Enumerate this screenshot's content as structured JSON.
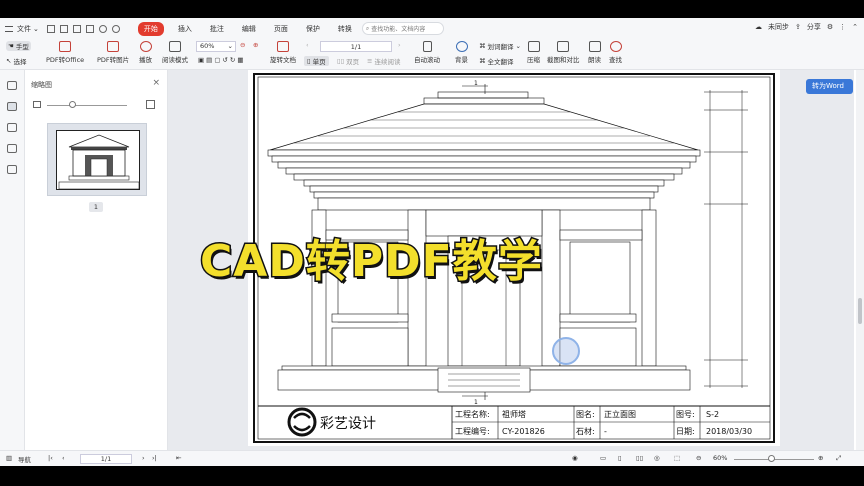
{
  "menubar": {
    "file_label": "文件",
    "tabs": [
      "开始",
      "插入",
      "批注",
      "编辑",
      "页面",
      "保护",
      "转换"
    ],
    "active_tab": "开始",
    "search_placeholder": "查找功能、文档内容",
    "unsynced": "未同步",
    "share": "分享"
  },
  "toolbar": {
    "hand": "手型",
    "select": "选择",
    "pdf_to_office": "PDF转Office",
    "pdf_to_image": "PDF转图片",
    "play": "播放",
    "read_mode": "阅读模式",
    "zoom": "60%",
    "rotate": "旋转文档",
    "page": "1/1",
    "single": "单页",
    "double": "双页",
    "continuous": "连续阅读",
    "auto_scroll": "自动滚动",
    "background": "背景",
    "word_translate": "划词翻译",
    "full_translate": "全文翻译",
    "compress": "压缩",
    "screenshot_compare": "截图和对比",
    "read_aloud": "朗读",
    "find": "查找"
  },
  "panel": {
    "title": "缩略图",
    "close": "×",
    "thumb_page": "1"
  },
  "canvas": {
    "to_word": "转为Word",
    "overlay_title": "CAD转PDF教学"
  },
  "drawing": {
    "mark_top": "1",
    "mark_bottom": "1",
    "logo_text": "彩艺设计",
    "project_name_label": "工程名称:",
    "project_name": "祖师塔",
    "project_no_label": "工程编号:",
    "project_no": "CY-201826",
    "drawing_name_label": "图名:",
    "drawing_name": "正立面图",
    "stone_label": "石材:",
    "stone": "-",
    "drawing_no_label": "图号:",
    "drawing_no": "S-2",
    "date_label": "日期:",
    "date": "2018/03/30"
  },
  "statusbar": {
    "nav": "导航",
    "page": "1/1",
    "zoom": "60%"
  },
  "colors": {
    "accent": "#e23b2e",
    "word_button": "#3a78d8",
    "overlay_fill": "#f3df2c"
  }
}
